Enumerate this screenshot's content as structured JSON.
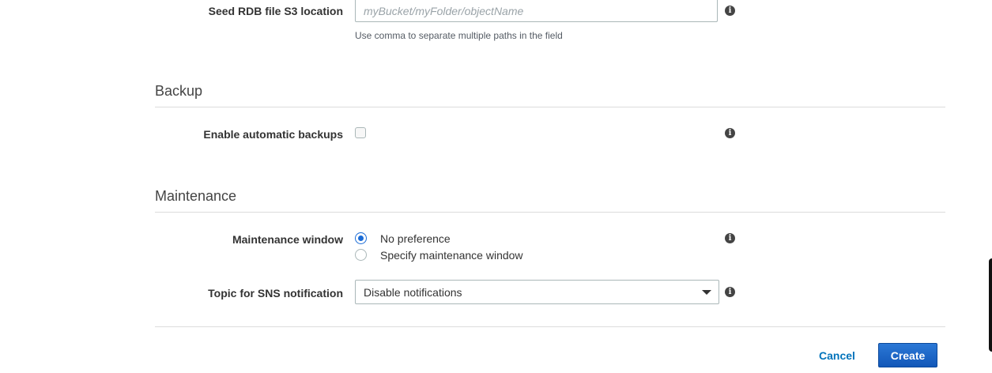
{
  "seed_rdb": {
    "label": "Seed RDB file S3 location",
    "placeholder": "myBucket/myFolder/objectName",
    "value": "",
    "help": "Use comma to separate multiple paths in the field"
  },
  "backup": {
    "title": "Backup",
    "enable_label": "Enable automatic backups",
    "enabled": false
  },
  "maintenance": {
    "title": "Maintenance",
    "window_label": "Maintenance window",
    "options": [
      {
        "label": "No preference",
        "selected": true
      },
      {
        "label": "Specify maintenance window",
        "selected": false
      }
    ],
    "sns_label": "Topic for SNS notification",
    "sns_value": "Disable notifications"
  },
  "info_icon_glyph": "i",
  "footer": {
    "cancel_label": "Cancel",
    "create_label": "Create"
  },
  "colors": {
    "accent": "#1a6bd6",
    "link": "#0073bb",
    "primary_button": "#1666c5"
  }
}
